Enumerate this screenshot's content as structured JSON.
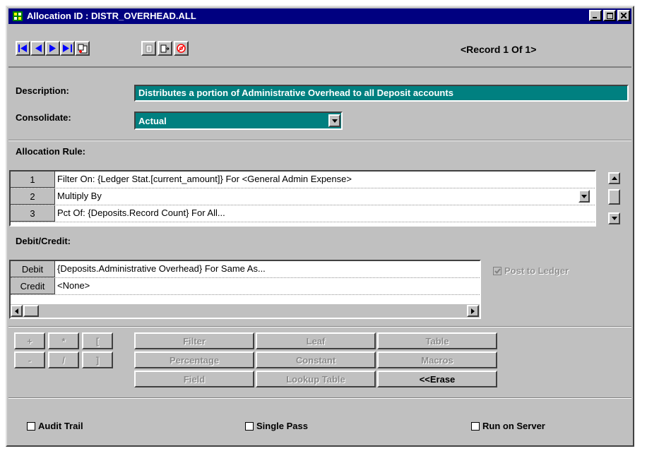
{
  "window": {
    "title": "Allocation ID : DISTR_OVERHEAD.ALL",
    "record_indicator": "<Record 1 Of 1>"
  },
  "form": {
    "description_label": "Description:",
    "description_value": "Distributes a portion of Administrative Overhead to all Deposit accounts",
    "consolidate_label": "Consolidate:",
    "consolidate_value": "Actual",
    "allocation_rule_label": "Allocation Rule:",
    "debit_credit_label": "Debit/Credit:"
  },
  "allocation_rules": [
    {
      "num": "1",
      "text": "Filter On: {Ledger Stat.[current_amount]} For  <General Admin Expense>"
    },
    {
      "num": "2",
      "text": "Multiply By"
    },
    {
      "num": "3",
      "text": "Pct Of: {Deposits.Record Count} For  All..."
    }
  ],
  "debit_credit": [
    {
      "label": "Debit",
      "text": "{Deposits.Administrative Overhead} For  Same As..."
    },
    {
      "label": "Credit",
      "text": "<None>"
    }
  ],
  "post_to_ledger": "Post to Ledger",
  "operators": {
    "plus": "+",
    "times": "*",
    "lbracket": "[",
    "minus": "-",
    "divide": "/",
    "rbracket": "]"
  },
  "buttons": {
    "filter": "Filter",
    "leaf": "Leaf",
    "table": "Table",
    "percentage": "Percentage",
    "constant": "Constant",
    "macros": "Macros",
    "field": "Field",
    "lookup_table": "Lookup Table",
    "erase": "<<Erase"
  },
  "options": {
    "audit_trail": "Audit Trail",
    "single_pass": "Single Pass",
    "run_on_server": "Run on Server"
  },
  "colors": {
    "titlebar": "#000080",
    "field_teal": "#008080",
    "face": "#c0c0c0"
  }
}
